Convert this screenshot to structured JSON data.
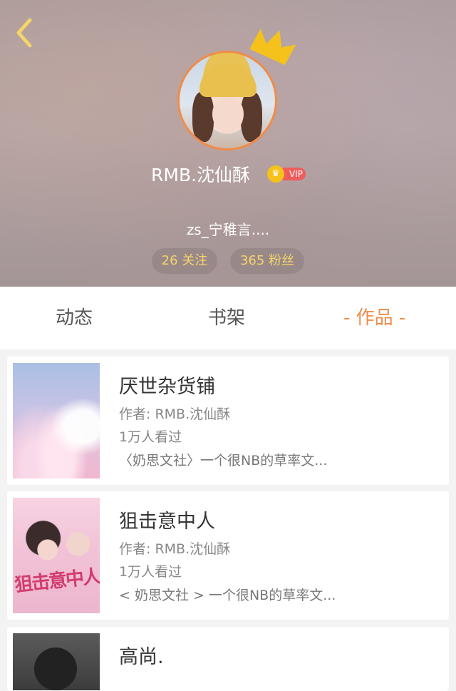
{
  "header": {
    "username": "RMB.沈仙酥",
    "vip_label": "VIP",
    "signature": "zs_宁稚言....",
    "follow_count_label": "26 关注",
    "fans_count_label": "365 粉丝"
  },
  "tabs": [
    {
      "label": "动态"
    },
    {
      "label": "书架"
    },
    {
      "label": "- 作品 -",
      "active": true
    }
  ],
  "works": [
    {
      "title": "厌世杂货铺",
      "author": "作者: RMB.沈仙酥",
      "views": "1万人看过",
      "desc": "〈奶思文社〉一个很NB的草率文..."
    },
    {
      "title": "狙击意中人",
      "cover_text": "狙击意中人",
      "author": "作者: RMB.沈仙酥",
      "views": "1万人看过",
      "desc": "< 奶思文社 > 一个很NB的草率文..."
    },
    {
      "title": "高尚."
    }
  ],
  "colors": {
    "accent": "#f08c4a",
    "stat_text": "#f3d56a",
    "vip_red": "#ee5d5b",
    "crown_yellow": "#f5c21b"
  },
  "icons": [
    "back-arrow-icon",
    "crown-icon",
    "vip-coin-icon"
  ]
}
